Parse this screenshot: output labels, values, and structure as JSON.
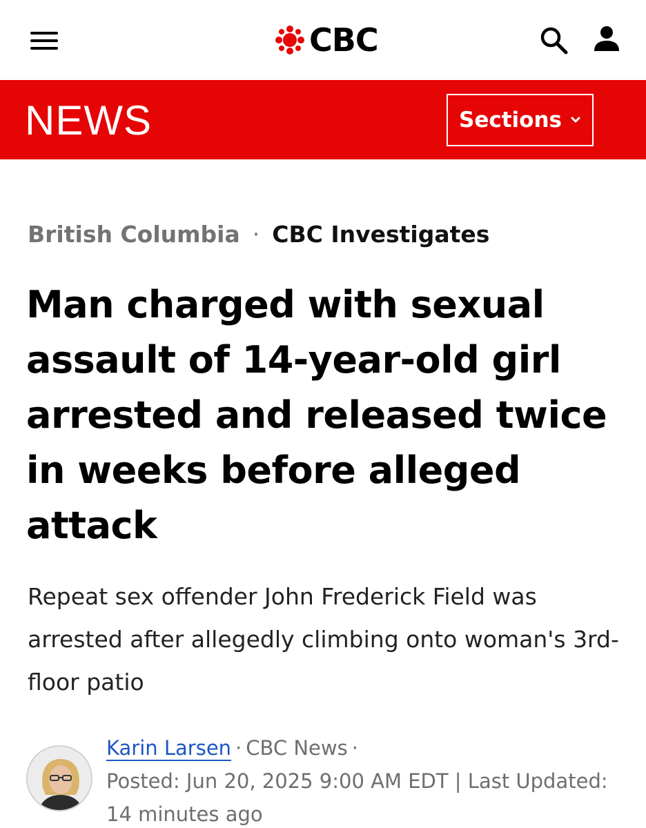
{
  "header": {
    "menu_icon": "hamburger-menu-icon",
    "logo_text": "CBC",
    "logo_icon": "cbc-gem-logo",
    "search_icon": "search-icon",
    "account_icon": "user-account-icon",
    "brand_red": "#e60505"
  },
  "newsbar": {
    "title": "NEWS",
    "sections_label": "Sections",
    "sections_icon": "chevron-down-icon"
  },
  "article": {
    "breadcrumb": {
      "region": "British Columbia",
      "separator": "·",
      "series": "CBC Investigates"
    },
    "headline": "Man charged with sexual assault of 14-year-old girl arrested and released twice in weeks before alleged attack",
    "deck": "Repeat sex offender John Frederick Field was arrested after allegedly climbing onto woman's 3rd-floor patio",
    "byline": {
      "author": "Karin Larsen",
      "sep1": "·",
      "outlet": "CBC News",
      "sep2": "·",
      "posted": "Posted: Jun 20, 2025 9:00 AM EDT | Last Updated: 14 minutes ago",
      "link_color": "#1d57c4"
    }
  }
}
